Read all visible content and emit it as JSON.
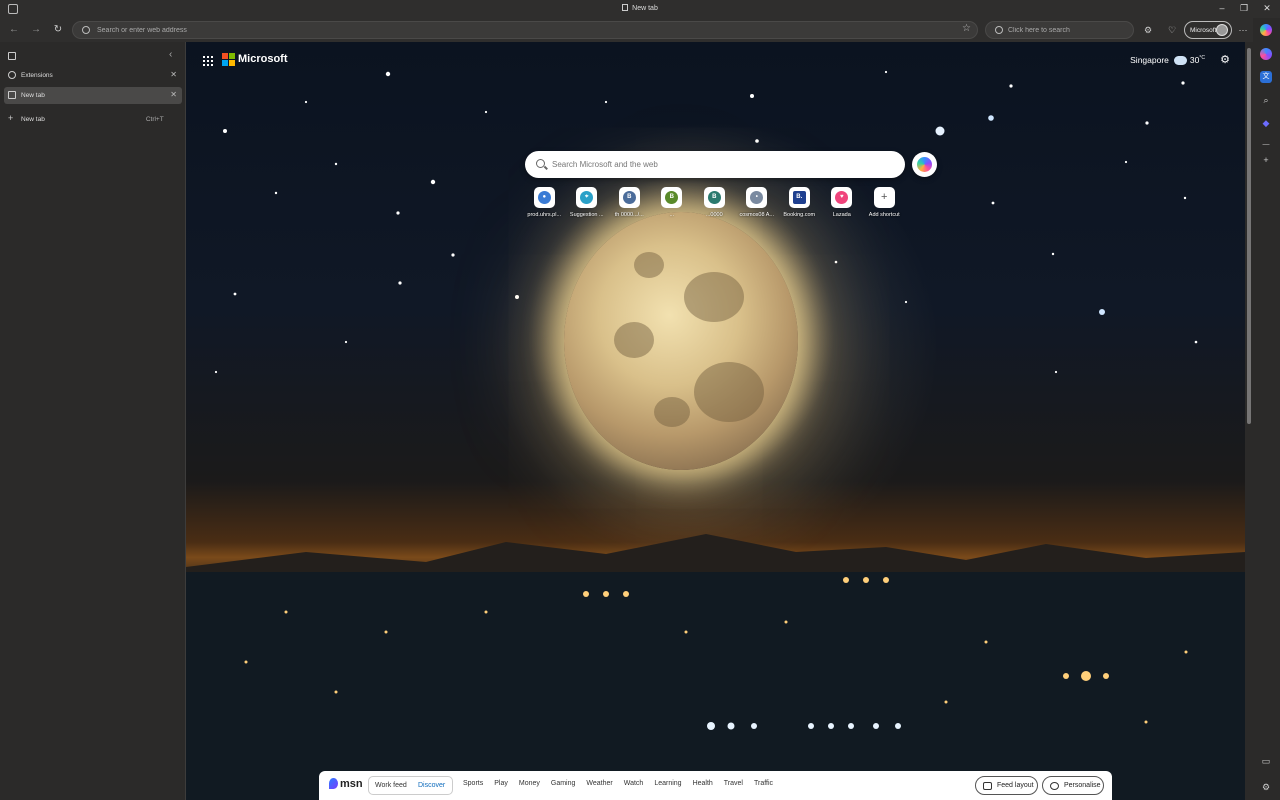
{
  "window": {
    "tab_title": "New tab",
    "minimize": "–",
    "restore": "❐",
    "close": "✕"
  },
  "toolbar": {
    "back": "←",
    "forward": "→",
    "refresh": "↻",
    "address_placeholder": "Search or enter web address",
    "favorite_icon": "☆",
    "search_placeholder": "Click here to search",
    "profile_label": "Microsoft",
    "more": "⋯"
  },
  "vertical_tabs": {
    "items": [
      {
        "label": "Extensions",
        "close": "✕",
        "active": false
      },
      {
        "label": "New tab",
        "close": "✕",
        "active": true
      }
    ],
    "new_tab_label": "New tab",
    "new_tab_shortcut": "Ctrl+T",
    "collapse": "‹"
  },
  "page": {
    "brand": "Microsoft",
    "location": "Singapore",
    "temperature": "30",
    "temp_unit": "°C",
    "search_placeholder": "Search Microsoft and the web",
    "shortcuts": [
      {
        "name": "prod.uhrs.pl...",
        "color": "#3a7bd5",
        "letter": "●"
      },
      {
        "name": "Suggestion ...",
        "color": "#2aa0c8",
        "letter": "⌖"
      },
      {
        "name": "th 0000.../...",
        "color": "#4b6c9a",
        "letter": "B"
      },
      {
        "name": "...",
        "color": "#5a8a2a",
        "letter": "B"
      },
      {
        "name": "...0000",
        "color": "#2b7a6e",
        "letter": "B"
      },
      {
        "name": "cosmos08 A...",
        "color": "#7a8aa0",
        "letter": "•"
      },
      {
        "name": "Booking.com",
        "color": "#1e3f8f",
        "letter": "B."
      },
      {
        "name": "Lazada",
        "color": "#f0447c",
        "letter": "♥"
      },
      {
        "name": "Add shortcut",
        "color": "#ffffff",
        "letter": "+"
      }
    ]
  },
  "msn": {
    "logo": "msn",
    "toggle": {
      "work": "Work feed",
      "discover": "Discover"
    },
    "nav": [
      "Sports",
      "Play",
      "Money",
      "Gaming",
      "Weather",
      "Watch",
      "Learning",
      "Health",
      "Travel",
      "Traffic"
    ],
    "feed_layout": "Feed layout",
    "personalise": "Personalise"
  },
  "colors": {
    "accent": "#0f6cbd",
    "page_bg": "#0b1320"
  }
}
